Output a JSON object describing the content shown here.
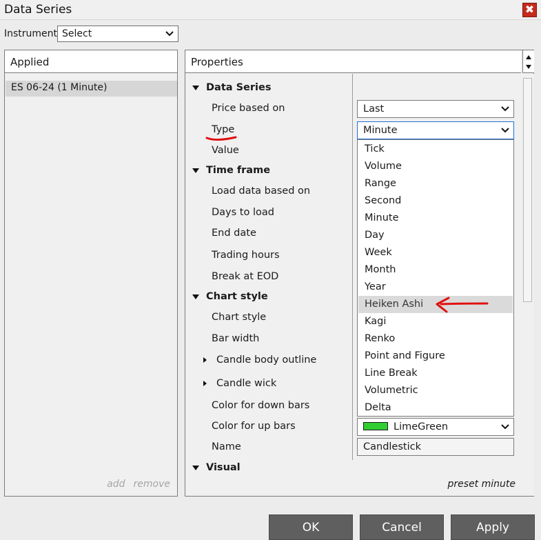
{
  "window": {
    "title": "Data Series",
    "close_glyph": "✖"
  },
  "instrument": {
    "label": "Instrument",
    "value": "Select"
  },
  "applied": {
    "header": "Applied",
    "items": [
      "ES 06-24 (1 Minute)"
    ],
    "add_label": "add",
    "remove_label": "remove"
  },
  "properties": {
    "header": "Properties",
    "preset_label": "preset minute",
    "data_series": {
      "label": "Data Series",
      "price_based_on": "Price based on",
      "type": "Type",
      "value": "Value"
    },
    "time_frame": {
      "label": "Time frame",
      "load_data_based_on": "Load data based on",
      "days_to_load": "Days to load",
      "end_date": "End date",
      "trading_hours": "Trading hours",
      "break_at_eod": "Break at EOD"
    },
    "chart_style": {
      "label": "Chart style",
      "chart_style": "Chart style",
      "bar_width": "Bar width",
      "candle_body_outline": "Candle body outline",
      "candle_wick": "Candle wick",
      "color_down": "Color for down bars",
      "color_up": "Color for up bars",
      "name": "Name"
    },
    "visual": {
      "label": "Visual"
    },
    "values": {
      "price_based_on": "Last",
      "type": "Minute",
      "color_up": "LimeGreen",
      "color_up_hex": "#32cd32",
      "name": "Candlestick"
    }
  },
  "type_dropdown": {
    "options": [
      "Tick",
      "Volume",
      "Range",
      "Second",
      "Minute",
      "Day",
      "Week",
      "Month",
      "Year",
      "Heiken Ashi",
      "Kagi",
      "Renko",
      "Point and Figure",
      "Line Break",
      "Volumetric",
      "Delta"
    ],
    "highlighted": "Heiken Ashi"
  },
  "buttons": {
    "ok": "OK",
    "cancel": "Cancel",
    "apply": "Apply"
  },
  "colors": {
    "annotation": "#e01010",
    "accent_focus": "#1e6fd9",
    "button_bg": "#5f5f5f"
  }
}
